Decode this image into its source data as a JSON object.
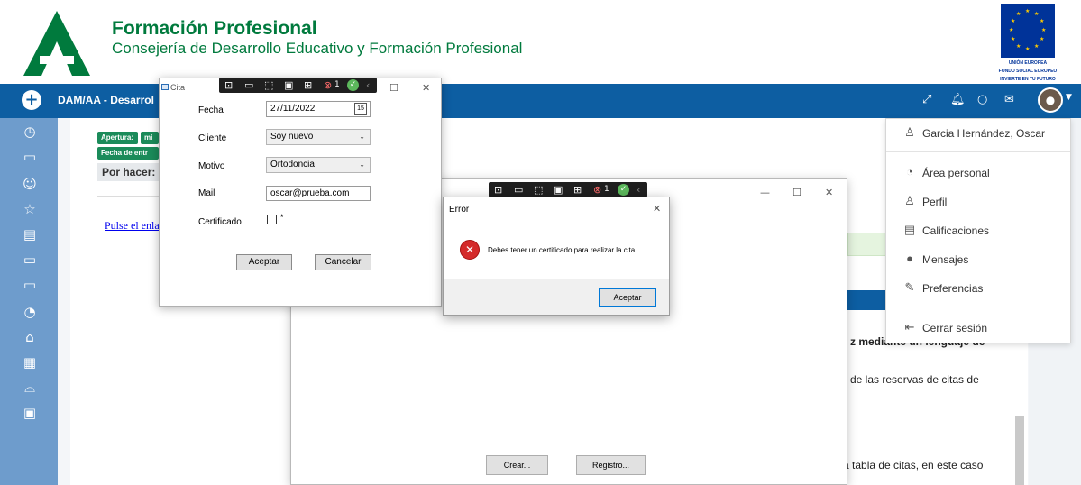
{
  "header": {
    "title": "Formación Profesional",
    "subtitle": "Consejería de Desarrollo Educativo y Formación Profesional",
    "eu_text": [
      "UNIÓN EUROPEA",
      "FONDO SOCIAL EUROPEO",
      "INVIERTE EN TU FUTURO"
    ]
  },
  "topnav": {
    "plus": "+",
    "course_title": "DAM/AA - Desarrol"
  },
  "page": {
    "badges": [
      "Apertura:",
      "mi",
      "Fecha de entr"
    ],
    "todo": "Por hacer:",
    "link": "Pulse el enla",
    "text_line1": "z mediante un lenguaje de",
    "text_line2": "de las reservas de citas de",
    "text_line3": "a tabla de citas, en este caso"
  },
  "user_menu": {
    "items": [
      {
        "icon": "user-icon",
        "label": "Garcia Hernández, Oscar"
      },
      {
        "icon": "dashboard-icon",
        "label": "Área personal"
      },
      {
        "icon": "profile-icon",
        "label": "Perfil"
      },
      {
        "icon": "grades-icon",
        "label": "Calificaciones"
      },
      {
        "icon": "messages-icon",
        "label": "Mensajes"
      },
      {
        "icon": "preferences-icon",
        "label": "Preferencias"
      },
      {
        "icon": "logout-icon",
        "label": "Cerrar sesión"
      }
    ]
  },
  "big_window": {
    "crear_label": "Crear...",
    "registro_label": "Registro..."
  },
  "debug_bar": {
    "badge": "1"
  },
  "cita": {
    "title": "Cita",
    "fecha_label": "Fecha",
    "fecha_value": "27/11/2022",
    "calendar_day": "15",
    "cliente_label": "Cliente",
    "cliente_value": "Soy nuevo",
    "motivo_label": "Motivo",
    "motivo_value": "Ortodoncia",
    "mail_label": "Mail",
    "mail_value": "oscar@prueba.com",
    "certificado_label": "Certificado",
    "required_mark": "*",
    "aceptar_label": "Aceptar",
    "cancelar_label": "Cancelar"
  },
  "error_dialog": {
    "title": "Error",
    "message": "Debes tener un certificado para realizar la cita.",
    "ok_label": "Aceptar"
  },
  "colors": {
    "nav_blue": "#0d5ea2",
    "sidebar_blue": "#6e9ccc",
    "brand_green": "#007a3d",
    "error_red": "#d42a2a"
  }
}
